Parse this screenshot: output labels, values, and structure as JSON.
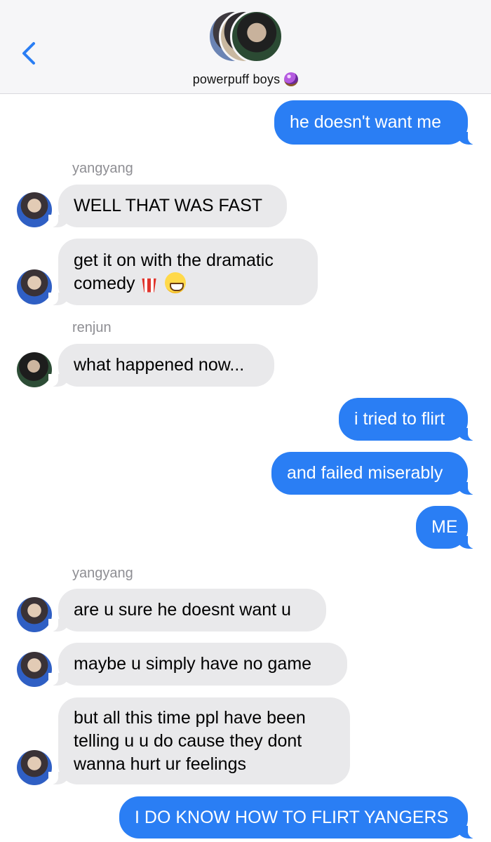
{
  "header": {
    "back_icon": "chevron-left-icon",
    "group_name": "powerpuff boys",
    "group_emoji_icon": "crystal-ball-icon",
    "accent_color": "#2a7ef4"
  },
  "messages": [
    {
      "from": "me",
      "lines": [
        "he doesn't want me"
      ]
    },
    {
      "sender_label": "yangyang"
    },
    {
      "from": "yangyang",
      "lines": [
        "WELL THAT WAS FAST"
      ]
    },
    {
      "from": "yangyang",
      "lines": [
        "get it on with the dramatic",
        "comedy"
      ],
      "emoji": [
        "popcorn-icon",
        "grinning-face-icon"
      ]
    },
    {
      "sender_label": "renjun"
    },
    {
      "from": "renjun",
      "lines": [
        "what happened now..."
      ]
    },
    {
      "from": "me",
      "lines": [
        "i tried to flirt"
      ]
    },
    {
      "from": "me",
      "lines": [
        "and failed miserably"
      ]
    },
    {
      "from": "me",
      "lines": [
        "ME"
      ]
    },
    {
      "sender_label": "yangyang"
    },
    {
      "from": "yangyang",
      "lines": [
        "are u sure he doesnt want u"
      ]
    },
    {
      "from": "yangyang",
      "lines": [
        "maybe u simply have no game"
      ]
    },
    {
      "from": "yangyang",
      "lines": [
        "but all this time ppl have been",
        "telling u u do cause they dont",
        "wanna hurt ur feelings"
      ]
    },
    {
      "from": "me",
      "lines": [
        "I DO KNOW HOW TO FLIRT YANGERS"
      ]
    }
  ]
}
